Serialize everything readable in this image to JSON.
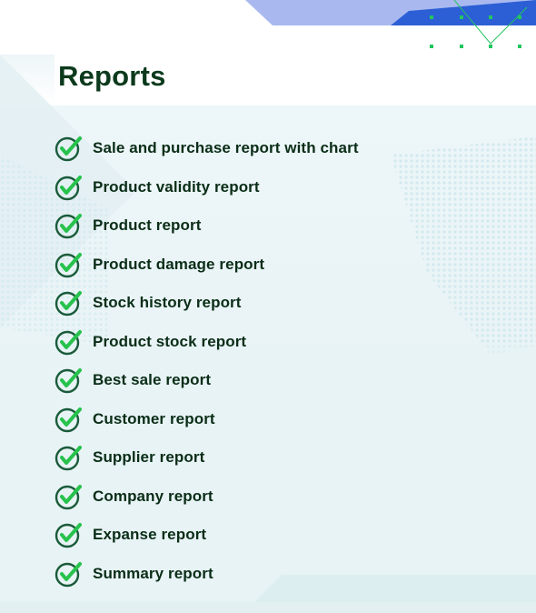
{
  "page": {
    "title": "Reports"
  },
  "report_list": {
    "items": [
      {
        "label": "Sale and purchase report with chart"
      },
      {
        "label": "Product validity report"
      },
      {
        "label": "Product report"
      },
      {
        "label": "Product damage report"
      },
      {
        "label": "Stock history report"
      },
      {
        "label": "Product stock report"
      },
      {
        "label": "Best sale report"
      },
      {
        "label": "Customer report"
      },
      {
        "label": "Supplier report"
      },
      {
        "label": "Company report"
      },
      {
        "label": "Expanse report"
      },
      {
        "label": "Summary report"
      }
    ]
  },
  "colors": {
    "title": "#0c3a1c",
    "label": "#0a2d17",
    "check_circle": "#1a5b3a",
    "check_mark": "#27c24c",
    "accent_blue": "#2c5fd6",
    "accent_light_blue": "#a9b9ef",
    "accent_green_dots": "#22c55e"
  }
}
